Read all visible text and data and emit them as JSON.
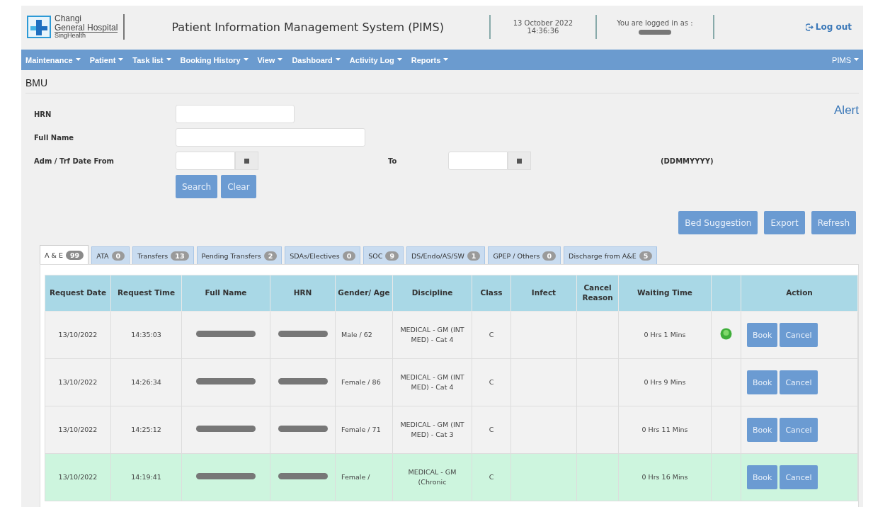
{
  "header": {
    "hospital_name": [
      "Changi",
      "General Hospital"
    ],
    "group": "SingHealth",
    "system_title": "Patient Information Management System (PIMS)",
    "date": "13 October 2022",
    "time": "14:36:36",
    "login_label": "You are logged in as :",
    "username_redacted": true,
    "logout": "Log out"
  },
  "nav": {
    "menus": [
      "Maintenance",
      "Patient",
      "Task list",
      "Booking History",
      "View",
      "Dashboard",
      "Activity Log",
      "Reports"
    ],
    "right_menu": "PIMS"
  },
  "page_title": "BMU",
  "alert": "Alert",
  "form": {
    "hrn_label": "HRN",
    "name_label": "Full Name",
    "date_from_label": "Adm / Trf Date From",
    "to_label": "To",
    "date_format": "(DDMMYYYY)",
    "buttons": [
      "Search",
      "Clear"
    ]
  },
  "actions": [
    "Bed Suggestion",
    "Export",
    "Refresh"
  ],
  "tabs": [
    {
      "label": "A & E",
      "count": "99",
      "selected": true
    },
    {
      "label": "ATA",
      "count": "0",
      "selected": false
    },
    {
      "label": "Transfers",
      "count": "13",
      "selected": false
    },
    {
      "label": "Pending Transfers",
      "count": "2",
      "selected": false
    },
    {
      "label": "SDAs/Electives",
      "count": "0",
      "selected": false
    },
    {
      "label": "SOC",
      "count": "9",
      "selected": false
    },
    {
      "label": "DS/Endo/AS/SW",
      "count": "1",
      "selected": false
    },
    {
      "label": "GPEP / Others",
      "count": "0",
      "selected": false
    },
    {
      "label": "Discharge from A&E",
      "count": "5",
      "selected": false
    }
  ],
  "table": {
    "columns": [
      "Request Date",
      "Request Time",
      "Full Name",
      "HRN",
      "Gender/ Age",
      "Discipline",
      "Class",
      "Infect",
      "Cancel Reason",
      "Waiting Time",
      "",
      "Action"
    ],
    "rows": [
      {
        "request_date": "13/10/2022",
        "request_time": "14:35:03",
        "name_redacted": true,
        "hrn_redacted": true,
        "gender_age": "Male / 62",
        "discipline": "MEDICAL - GM (INT MED) - Cat 4",
        "class": "C",
        "waiting_time": "0 Hrs 1 Mins",
        "flagged": true,
        "highlighted": false,
        "buttons": [
          "Book",
          "Cancel"
        ]
      },
      {
        "request_date": "13/10/2022",
        "request_time": "14:26:34",
        "name_redacted": true,
        "hrn_redacted": true,
        "gender_age": "Female / 86",
        "discipline": "MEDICAL - GM (INT MED) - Cat 4",
        "class": "C",
        "waiting_time": "0 Hrs 9 Mins",
        "flagged": false,
        "highlighted": false,
        "buttons": [
          "Book",
          "Cancel"
        ]
      },
      {
        "request_date": "13/10/2022",
        "request_time": "14:25:12",
        "name_redacted": true,
        "hrn_redacted": true,
        "gender_age": "Female / 71",
        "discipline": "MEDICAL - GM (INT MED) - Cat 3",
        "class": "C",
        "waiting_time": "0 Hrs 11 Mins",
        "flagged": false,
        "highlighted": false,
        "buttons": [
          "Book",
          "Cancel"
        ]
      },
      {
        "request_date": "13/10/2022",
        "request_time": "14:19:41",
        "name_redacted": true,
        "hrn_redacted": true,
        "gender_age": "Female /",
        "discipline": "MEDICAL - GM (Chronic",
        "class": "C",
        "waiting_time": "0 Hrs 16 Mins",
        "flagged": false,
        "highlighted": true,
        "buttons": [
          "Book",
          "Cancel"
        ]
      }
    ]
  }
}
